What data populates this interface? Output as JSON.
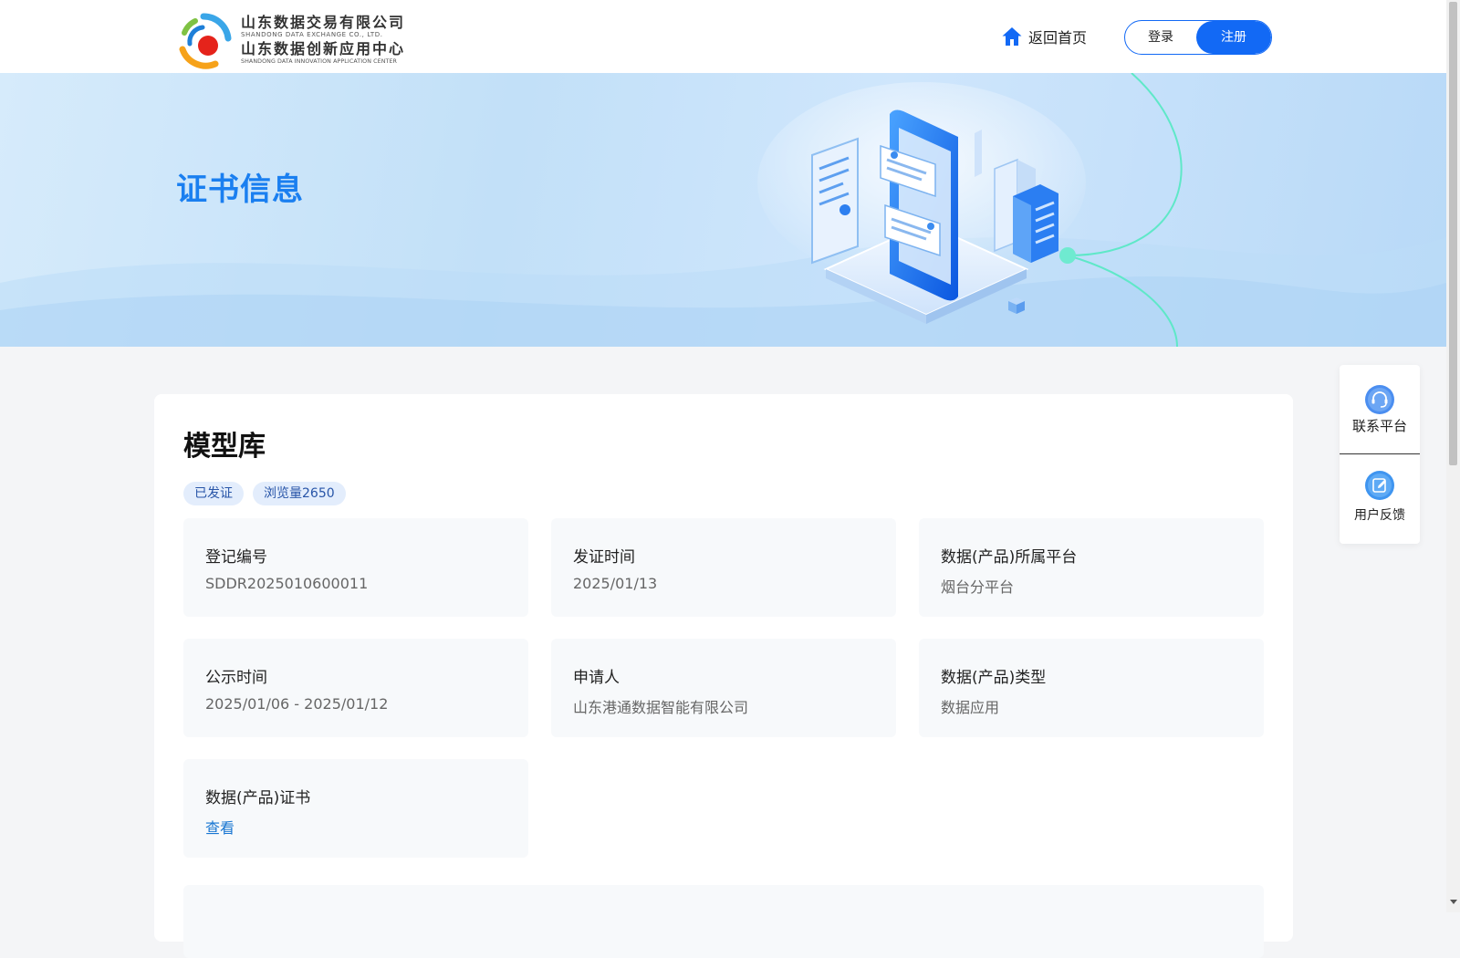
{
  "header": {
    "logo": {
      "line1": "山东数据交易有限公司",
      "sub1": "SHANDONG DATA EXCHANGE CO., LTD.",
      "line2": "山东数据创新应用中心",
      "sub2": "SHANDONG DATA INNOVATION APPLICATION CENTER"
    },
    "home_label": "返回首页",
    "login_label": "登录",
    "register_label": "注册",
    "accent_color": "#1269f5"
  },
  "banner": {
    "title": "证书信息"
  },
  "product": {
    "title": "模型库",
    "tags": [
      "已发证",
      "浏览量2650"
    ],
    "fields": [
      {
        "label": "登记编号",
        "value": "SDDR2025010600011"
      },
      {
        "label": "发证时间",
        "value": "2025/01/13"
      },
      {
        "label": "数据(产品)所属平台",
        "value": "烟台分平台"
      },
      {
        "label": "公示时间",
        "value": "2025/01/06 - 2025/01/12"
      },
      {
        "label": "申请人",
        "value": "山东港通数据智能有限公司"
      },
      {
        "label": "数据(产品)类型",
        "value": "数据应用"
      },
      {
        "label": "数据(产品)证书",
        "value": "查看"
      }
    ]
  },
  "side_widget": {
    "contact_label": "联系平台",
    "feedback_label": "用户反馈",
    "contact_icon": "headset-icon",
    "feedback_icon": "edit-icon"
  }
}
